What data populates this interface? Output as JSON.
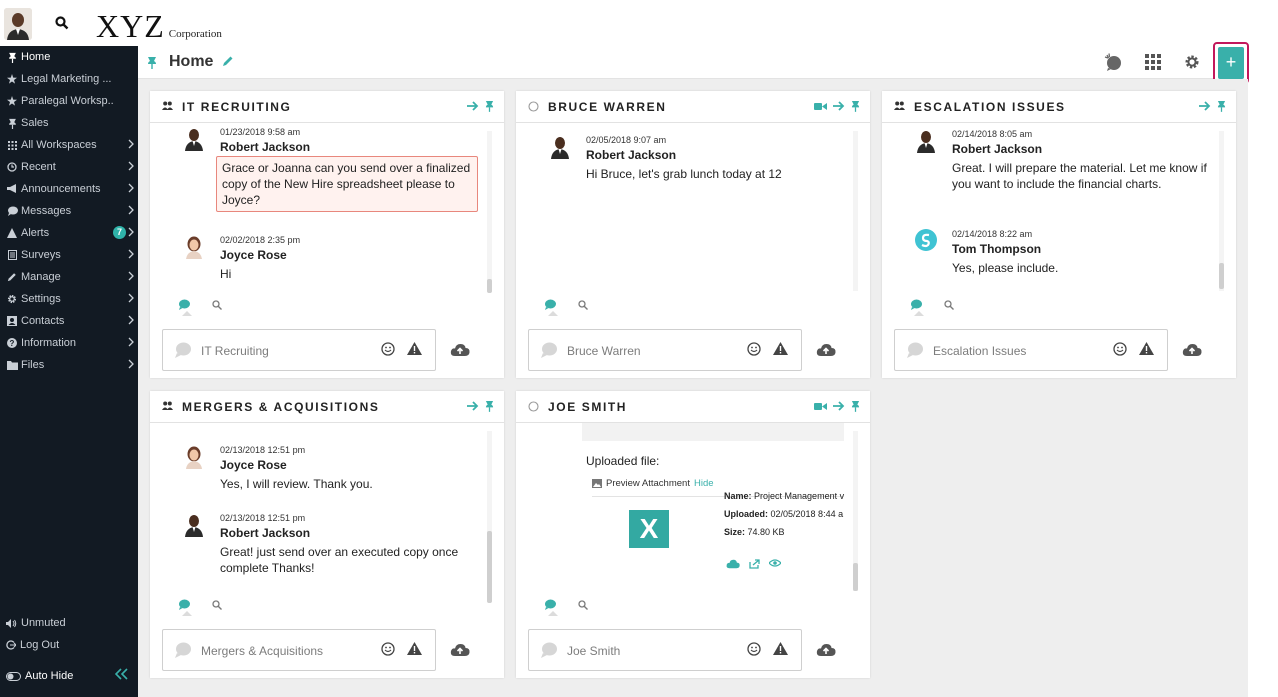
{
  "brand": {
    "logo_big": "XYZ",
    "logo_small": "Corporation"
  },
  "sidebar": {
    "items": [
      {
        "label": "Home",
        "icon": "pin-icon",
        "chevron": false
      },
      {
        "label": "Legal Marketing ...",
        "icon": "star-icon",
        "chevron": false
      },
      {
        "label": "Paralegal Worksp...",
        "icon": "star-icon",
        "chevron": false
      },
      {
        "label": "Sales",
        "icon": "pin-icon",
        "chevron": false
      },
      {
        "label": "All Workspaces",
        "icon": "grid-icon",
        "chevron": true
      },
      {
        "label": "Recent",
        "icon": "clock-icon",
        "chevron": true
      },
      {
        "label": "Announcements",
        "icon": "megaphone-icon",
        "chevron": true
      },
      {
        "label": "Messages",
        "icon": "chat-icon",
        "chevron": true
      },
      {
        "label": "Alerts",
        "icon": "warning-icon",
        "chevron": true,
        "badge": "7"
      },
      {
        "label": "Surveys",
        "icon": "survey-icon",
        "chevron": true
      },
      {
        "label": "Manage",
        "icon": "pencil-icon",
        "chevron": true
      },
      {
        "label": "Settings",
        "icon": "gear-icon",
        "chevron": true
      },
      {
        "label": "Contacts",
        "icon": "contact-icon",
        "chevron": true
      },
      {
        "label": "Information",
        "icon": "info-icon",
        "chevron": true
      },
      {
        "label": "Files",
        "icon": "folder-icon",
        "chevron": true
      }
    ],
    "unmuted": "Unmuted",
    "logout": "Log Out",
    "auto_hide": "Auto Hide"
  },
  "header": {
    "title": "Home"
  },
  "colors": {
    "accent": "#39b0aa",
    "sidebar_bg": "#121a23",
    "highlight_border": "#c2185b"
  },
  "panels": [
    {
      "title": "IT RECRUITING",
      "type": "group",
      "input_placeholder": "IT Recruiting",
      "messages": [
        {
          "time": "01/23/2018 9:58 am",
          "name": "Robert Jackson",
          "text": "Grace or Joanna can you send over a finalized copy of the New Hire spreadsheet please to Joyce?",
          "highlight": true
        },
        {
          "time": "02/02/2018 2:35 pm",
          "name": "Joyce Rose",
          "text": "Hi"
        }
      ]
    },
    {
      "title": "BRUCE WARREN",
      "type": "direct",
      "input_placeholder": "Bruce Warren",
      "messages": [
        {
          "time": "02/05/2018 9:07 am",
          "name": "Robert Jackson",
          "text": "Hi Bruce, let's grab lunch today at 12"
        }
      ]
    },
    {
      "title": "ESCALATION ISSUES",
      "type": "group",
      "input_placeholder": "Escalation Issues",
      "messages": [
        {
          "time": "02/14/2018 8:05 am",
          "name": "Robert Jackson",
          "text": "Great.  I will prepare the material.  Let me know if you want to include the financial charts."
        },
        {
          "time": "02/14/2018 8:22 am",
          "name": "Tom Thompson",
          "text": "Yes, please include."
        }
      ]
    },
    {
      "title": "MERGERS & ACQUISITIONS",
      "type": "group",
      "input_placeholder": "Mergers & Acquisitions",
      "messages": [
        {
          "time": "02/13/2018 12:51 pm",
          "name": "Joyce Rose",
          "text": "Yes, I will review.  Thank you."
        },
        {
          "time": "02/13/2018 12:51 pm",
          "name": "Robert Jackson",
          "text": "Great! just send over an executed copy once complete Thanks!"
        }
      ]
    },
    {
      "title": "JOE SMITH",
      "type": "direct",
      "input_placeholder": "Joe Smith",
      "attachment": {
        "uploaded_label": "Uploaded file:",
        "preview_label": "Preview Attachment",
        "hide_label": "Hide",
        "name_label": "Name:",
        "name_value": "Project Management v",
        "uploaded_key": "Uploaded:",
        "uploaded_value": "02/05/2018 8:44 a",
        "size_label": "Size:",
        "size_value": "74.80 KB",
        "file_glyph": "X"
      }
    }
  ]
}
